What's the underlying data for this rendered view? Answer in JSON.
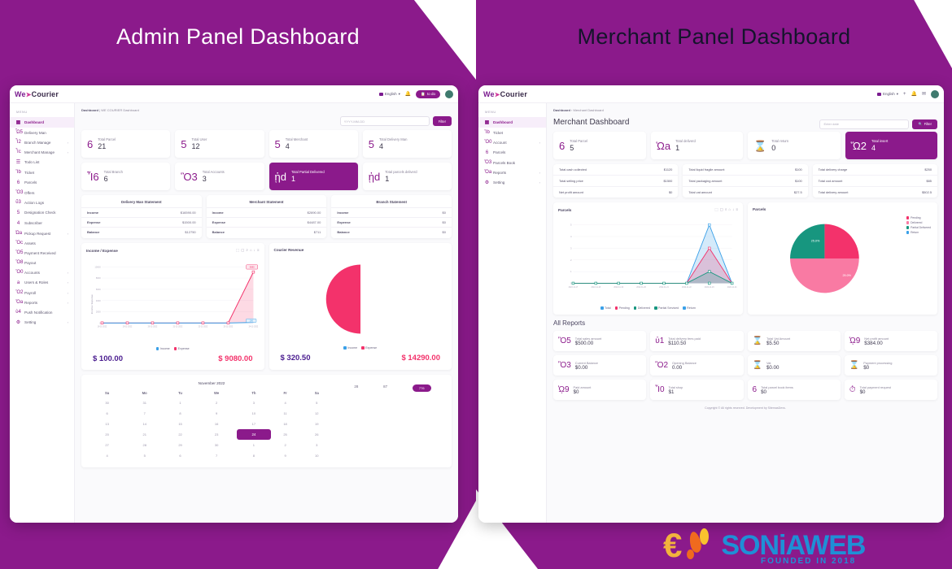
{
  "page": {
    "left_title": "Admin Panel Dashboard",
    "right_title": "Merchant Panel Dashboard",
    "accent_purple": "#8b1a8b",
    "accent_pink": "#f3326b",
    "accent_teal": "#17967f"
  },
  "brand": {
    "part1": "We",
    "caret": "➤",
    "part2": "Courier"
  },
  "topbar": {
    "language": "English",
    "lang_caret": "▾",
    "bell_icon": "bell-icon",
    "pill_label": "to do",
    "pill_icon": "clipboard-icon",
    "plus_icon": "plus-icon",
    "mail_icon": "mail-icon",
    "avatar": "avatar"
  },
  "admin": {
    "sidebar": {
      "heading": "MENU",
      "items": [
        {
          "label": "Dashboard",
          "icon": "dashboard-icon",
          "glyph": "▦",
          "active": true,
          "arrow": ""
        },
        {
          "label": "Delivery Man",
          "icon": "delivery-man-icon",
          "glyph": "Ὧ5",
          "active": false,
          "arrow": ""
        },
        {
          "label": "Branch Manage",
          "icon": "branch-icon",
          "glyph": "Ἶ2",
          "active": false,
          "arrow": "›"
        },
        {
          "label": "Merchant Manage",
          "icon": "merchant-icon",
          "glyph": "Ἶc",
          "active": false,
          "arrow": "›"
        },
        {
          "label": "Todo List",
          "icon": "todo-icon",
          "glyph": "☰",
          "active": false,
          "arrow": ""
        },
        {
          "label": "Ticket",
          "icon": "ticket-icon",
          "glyph": "Ἲb",
          "active": false,
          "arrow": ""
        },
        {
          "label": "Parcels",
          "icon": "parcel-icon",
          "glyph": "὎6",
          "active": false,
          "arrow": ""
        },
        {
          "label": "Offers",
          "icon": "offer-icon",
          "glyph": "Ὃ3",
          "active": false,
          "arrow": ""
        },
        {
          "label": "Action Logs",
          "icon": "log-icon",
          "glyph": "ὕ3",
          "active": false,
          "arrow": ""
        },
        {
          "label": "Designation Check",
          "icon": "designation-icon",
          "glyph": "὆5",
          "active": false,
          "arrow": ""
        },
        {
          "label": "Subscriber",
          "icon": "subscriber-icon",
          "glyph": "὆4",
          "active": false,
          "arrow": ""
        },
        {
          "label": "Pickup Request",
          "icon": "pickup-icon",
          "glyph": "Ὡa",
          "active": false,
          "arrow": "›"
        },
        {
          "label": "Assets",
          "icon": "assets-icon",
          "glyph": "Ὃc",
          "active": false,
          "arrow": ""
        },
        {
          "label": "Payment Received",
          "icon": "payment-icon",
          "glyph": "Ὃ5",
          "active": false,
          "arrow": ""
        },
        {
          "label": "Payout",
          "icon": "payout-icon",
          "glyph": "Ὃ8",
          "active": false,
          "arrow": ""
        },
        {
          "label": "Accounts",
          "icon": "accounts-icon",
          "glyph": "Ὃ0",
          "active": false,
          "arrow": "›"
        },
        {
          "label": "Users & Roles",
          "icon": "users-roles-icon",
          "glyph": "὆a",
          "active": false,
          "arrow": "›"
        },
        {
          "label": "Payroll",
          "icon": "payroll-icon",
          "glyph": "Ὃ2",
          "active": false,
          "arrow": "›"
        },
        {
          "label": "Reports",
          "icon": "reports-icon",
          "glyph": "Ὄa",
          "active": false,
          "arrow": "›"
        },
        {
          "label": "Push Notification",
          "icon": "push-icon",
          "glyph": "ὑ4",
          "active": false,
          "arrow": ""
        },
        {
          "label": "Setting",
          "icon": "setting-icon",
          "glyph": "⚙",
          "active": false,
          "arrow": "›"
        }
      ]
    },
    "breadcrumb": {
      "root": "Dashboard",
      "sep": "|",
      "current": "WE COURIER Dashboard"
    },
    "search": {
      "placeholder": "YYYY-MM-DD",
      "filter_label": "Filter"
    },
    "stats": [
      {
        "label": "Total Parcel",
        "value": "21",
        "icon": "parcel-box-icon",
        "glyph": "὎6",
        "highlight": false
      },
      {
        "label": "Total User",
        "value": "12",
        "icon": "users-icon",
        "glyph": "὆5",
        "highlight": false
      },
      {
        "label": "Total Merchant",
        "value": "4",
        "icon": "merchants-icon",
        "glyph": "὆5",
        "highlight": false
      },
      {
        "label": "Total Delivery Man",
        "value": "4",
        "icon": "delivery-men-icon",
        "glyph": "὆5",
        "highlight": false
      },
      {
        "label": "Total Branch",
        "value": "6",
        "icon": "branch-building-icon",
        "glyph": "Ἶ6",
        "highlight": false
      },
      {
        "label": "Total Accounts",
        "value": "3",
        "icon": "card-icon",
        "glyph": "Ὃ3",
        "highlight": false
      },
      {
        "label": "Total Partial Delivered",
        "value": "1",
        "icon": "handshake-icon",
        "glyph": "ᾑd",
        "highlight": true
      },
      {
        "label": "Total parcels deliverd",
        "value": "1",
        "icon": "handshake-icon",
        "glyph": "ᾑd",
        "highlight": false
      }
    ],
    "statements": [
      {
        "title": "Delivery Man Statement",
        "rows": [
          {
            "label": "Income",
            "value": "$16590.00"
          },
          {
            "label": "Expense",
            "value": "$1500.00"
          },
          {
            "label": "Balance",
            "value": "$12750"
          }
        ]
      },
      {
        "title": "Merchant Statement",
        "rows": [
          {
            "label": "Income",
            "value": "$2890.00"
          },
          {
            "label": "Expense",
            "value": "$4487.00"
          },
          {
            "label": "Balance",
            "value": "$711"
          }
        ]
      },
      {
        "title": "Branch Statement",
        "rows": [
          {
            "label": "Income",
            "value": "$0"
          },
          {
            "label": "Expense",
            "value": "$0"
          },
          {
            "label": "Balance",
            "value": "$0"
          }
        ]
      }
    ],
    "chart_tools": [
      "⬚",
      "▢",
      "⌕",
      "⌂",
      "↓",
      "≡"
    ],
    "calendar": {
      "month": "November 2022",
      "weekdays": [
        "Su",
        "Mo",
        "Tu",
        "We",
        "Th",
        "Fr",
        "Sa"
      ],
      "weeks": [
        [
          "30",
          "31",
          "1",
          "2",
          "3",
          "4",
          "5"
        ],
        [
          "6",
          "7",
          "8",
          "9",
          "10",
          "11",
          "12"
        ],
        [
          "13",
          "14",
          "15",
          "16",
          "17",
          "18",
          "19"
        ],
        [
          "20",
          "21",
          "22",
          "23",
          "24",
          "25",
          "26"
        ],
        [
          "27",
          "28",
          "29",
          "30",
          "1",
          "2",
          "3"
        ],
        [
          "4",
          "5",
          "6",
          "7",
          "8",
          "9",
          "10"
        ]
      ],
      "selected_day": "24",
      "label_left": "28",
      "label_right": "87",
      "pill": "776"
    }
  },
  "merchant": {
    "sidebar": {
      "heading": "MENU",
      "items": [
        {
          "label": "Dashboard",
          "icon": "dashboard-icon",
          "glyph": "▦",
          "active": true,
          "arrow": ""
        },
        {
          "label": "Ticket",
          "icon": "ticket-icon",
          "glyph": "Ἲb",
          "active": false,
          "arrow": ""
        },
        {
          "label": "Account",
          "icon": "accounts-icon",
          "glyph": "Ὃ0",
          "active": false,
          "arrow": "›"
        },
        {
          "label": "Parcels",
          "icon": "parcel-icon",
          "glyph": "὎6",
          "active": false,
          "arrow": ""
        },
        {
          "label": "Parcels Book",
          "icon": "parcel-book-icon",
          "glyph": "Ὅ3",
          "active": false,
          "arrow": ""
        },
        {
          "label": "Reports",
          "icon": "reports-icon",
          "glyph": "Ὄa",
          "active": false,
          "arrow": "›"
        },
        {
          "label": "Setting",
          "icon": "setting-icon",
          "glyph": "⚙",
          "active": false,
          "arrow": "›"
        }
      ]
    },
    "breadcrumb": {
      "root": "Dashboard",
      "sep": "›",
      "current": "Merchant Dashboard"
    },
    "page_title": "Merchant Dashboard",
    "search": {
      "placeholder": "Enter date",
      "filter_label": "Filter",
      "filter_icon": "search-icon"
    },
    "stats": [
      {
        "label": "Total Parcel",
        "value": "5",
        "icon": "parcel-box-icon",
        "glyph": "὎6",
        "highlight": false
      },
      {
        "label": "Total deliverd",
        "value": "1",
        "icon": "truck-icon",
        "glyph": "Ὡa",
        "highlight": false
      },
      {
        "label": "Total return",
        "value": "0",
        "icon": "hourglass-icon",
        "glyph": "⌛",
        "highlight": false
      },
      {
        "label": "Total insert",
        "value": "4",
        "icon": "cart-icon",
        "glyph": "Ὥ2",
        "highlight": true
      }
    ],
    "summary": [
      [
        {
          "label": "Total cash collected",
          "value": "$1120"
        },
        {
          "label": "Total selling price",
          "value": "$1500"
        },
        {
          "label": "Net profit amount",
          "value": "$0"
        }
      ],
      [
        {
          "label": "Total liquid fragile amount",
          "value": "$100"
        },
        {
          "label": "Total packaging amount",
          "value": "$100"
        },
        {
          "label": "Total vat amount",
          "value": "$27.5"
        }
      ],
      [
        {
          "label": "Total delivery charge",
          "value": "$250"
        },
        {
          "label": "Total cod amount",
          "value": "$85"
        },
        {
          "label": "Total delivery amount",
          "value": "$502.5"
        }
      ]
    ],
    "reports_title": "All Reports",
    "reports": [
      {
        "label": "Total sales amount",
        "value": "$500.00",
        "icon": "cash-hand-icon",
        "glyph": "Ὃ5"
      },
      {
        "label": "Total delivery fees paid",
        "value": "$110.50",
        "icon": "exchange-icon",
        "glyph": "ὐ1"
      },
      {
        "label": "Total Vat Amount",
        "value": "$5.50",
        "icon": "hourglass-icon",
        "glyph": "⌛"
      },
      {
        "label": "Net profit amount",
        "value": "$384.00",
        "icon": "coins-icon",
        "glyph": "ᾩ9"
      },
      {
        "label": "Current Balance",
        "value": "$0.00",
        "icon": "card-icon",
        "glyph": "Ὃ3"
      },
      {
        "label": "Opening Balance",
        "value": "0.00",
        "icon": "coin-dollar-icon",
        "glyph": "Ὃ2"
      },
      {
        "label": "Vat",
        "value": "$0.00",
        "icon": "hourglass-icon",
        "glyph": "⌛"
      },
      {
        "label": "Payment processing",
        "value": "$0",
        "icon": "hourglass-icon",
        "glyph": "⌛"
      },
      {
        "label": "Paid amount",
        "value": "$0",
        "icon": "coins-icon",
        "glyph": "ᾩ9"
      },
      {
        "label": "Total shop",
        "value": "$1",
        "icon": "home-icon",
        "glyph": "Ἶ0"
      },
      {
        "label": "Total parcel book items",
        "value": "$0",
        "icon": "parcel-items-icon",
        "glyph": "὎6"
      },
      {
        "label": "Total payment request",
        "value": "$0",
        "icon": "history-icon",
        "glyph": "⏱"
      }
    ],
    "footer": "Copyright © All rights reserved. Development by SitemasDevs."
  },
  "chart_data": [
    {
      "id": "income-expense",
      "type": "line",
      "title": "Income / Expense",
      "xlabel": "",
      "ylabel": "Income / Expense",
      "x": [
        "18-11-2022",
        "19-11-2022",
        "20-11-2022",
        "21-11-2022",
        "22-11-2022",
        "23-11-2022",
        "24-11-2022"
      ],
      "ylim": [
        0,
        10000
      ],
      "yticks": [
        0,
        2000,
        4000,
        6000,
        8000,
        10000
      ],
      "series": [
        {
          "name": "Income",
          "color": "#3aa0e8",
          "values": [
            0,
            0,
            0,
            0,
            0,
            0,
            100
          ]
        },
        {
          "name": "Expense",
          "color": "#f3326b",
          "values": [
            0,
            0,
            0,
            0,
            0,
            0,
            9080
          ]
        }
      ],
      "annotations": [
        {
          "text": "9080",
          "series": "Expense",
          "x": "24-11-2022"
        },
        {
          "text": "100",
          "series": "Income",
          "x": "24-11-2022"
        }
      ],
      "totals": {
        "income": "$ 100.00",
        "expense": "$ 9080.00"
      },
      "legend_position": "bottom"
    },
    {
      "id": "courier-revenue",
      "type": "pie",
      "title": "Courier Revenue",
      "labels": [
        "Income",
        "Expense"
      ],
      "values": [
        0,
        100
      ],
      "colors": [
        "#3aa0e8",
        "#f3326b"
      ],
      "totals": {
        "income": "$ 320.50",
        "expense": "$ 14290.00"
      },
      "legend_position": "bottom"
    },
    {
      "id": "merchant-parcels-area",
      "type": "area",
      "title": "Parcels",
      "x": [
        "2022-11-17",
        "2022-11-18",
        "2022-11-19",
        "2022-11-20",
        "2022-11-21",
        "2022-11-22",
        "2022-11-23",
        "2022-11-24"
      ],
      "ylim": [
        0,
        5
      ],
      "yticks": [
        0,
        1,
        2,
        3,
        4,
        5
      ],
      "series": [
        {
          "name": "Total",
          "color": "#3aa0e8",
          "values": [
            0,
            0,
            0,
            0,
            0,
            0,
            5,
            0
          ]
        },
        {
          "name": "Pending",
          "color": "#f3326b",
          "values": [
            0,
            0,
            0,
            0,
            0,
            0,
            3,
            0
          ]
        },
        {
          "name": "Delivered",
          "color": "#17967f",
          "values": [
            0,
            0,
            0,
            0,
            0,
            0,
            0,
            0
          ]
        },
        {
          "name": "Partial Serviced",
          "color": "#17967f",
          "values": [
            0,
            0,
            0,
            0,
            0,
            0,
            1,
            0
          ]
        },
        {
          "name": "Return",
          "color": "#3aa0e8",
          "values": [
            0,
            0,
            0,
            0,
            0,
            0,
            0,
            0
          ]
        }
      ],
      "legend_position": "bottom"
    },
    {
      "id": "merchant-parcels-pie",
      "type": "pie",
      "title": "Parcels",
      "labels": [
        "Pending",
        "Delivered",
        "Partial Delivered",
        "Return"
      ],
      "values": [
        50,
        25,
        25,
        0
      ],
      "colors": [
        "#f3326b",
        "#f97aa3",
        "#17967f",
        "#3aa0e8"
      ],
      "slice_labels": [
        "25.0%",
        "25.0%"
      ],
      "legend_position": "right"
    }
  ],
  "bottom_brand": {
    "euro": "€",
    "text": "SONiAWEB",
    "sub": "FOUNDED IN 2018"
  }
}
